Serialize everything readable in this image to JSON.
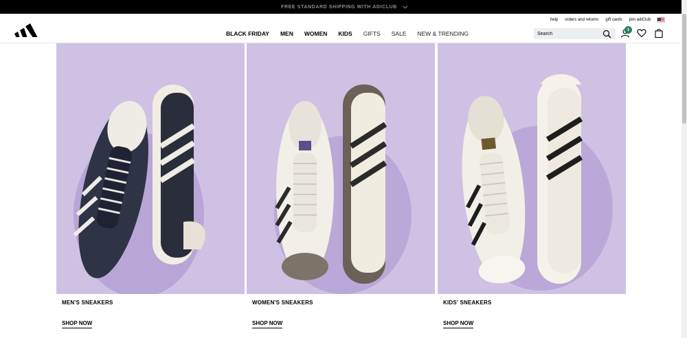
{
  "banner": {
    "text": "FREE STANDARD SHIPPING WITH ADICLUB"
  },
  "utility_links": [
    {
      "label": "help"
    },
    {
      "label": "orders and returns"
    },
    {
      "label": "gift cards"
    },
    {
      "label": "join adiClub"
    }
  ],
  "nav": [
    {
      "label": "BLACK FRIDAY"
    },
    {
      "label": "MEN"
    },
    {
      "label": "WOMEN"
    },
    {
      "label": "KIDS"
    },
    {
      "label": "GIFTS"
    },
    {
      "label": "SALE"
    },
    {
      "label": "NEW & TRENDING"
    }
  ],
  "search": {
    "placeholder": "Search"
  },
  "account": {
    "badge_count": "1"
  },
  "icons": [
    "adidas-logo",
    "us-flag-icon",
    "search-icon",
    "account-icon",
    "wishlist-icon",
    "bag-icon",
    "chevron-down-icon"
  ],
  "colors": {
    "banner_bg": "#000000",
    "card_bg": "#cfc1e4",
    "badge": "#2f7d62"
  },
  "cards": [
    {
      "title": "MEN'S SNEAKERS",
      "cta": "SHOP NOW",
      "shoe_color": "#2e3346"
    },
    {
      "title": "WOMEN'S SNEAKERS",
      "cta": "SHOP NOW",
      "shoe_color": "#f1efe8"
    },
    {
      "title": "KIDS' SNEAKERS",
      "cta": "SHOP NOW",
      "shoe_color": "#f2efe6"
    }
  ]
}
